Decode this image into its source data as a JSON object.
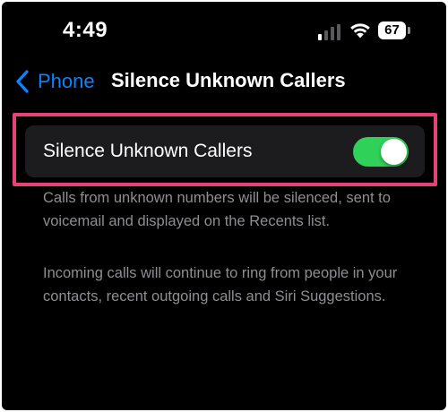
{
  "status_bar": {
    "time": "4:49",
    "battery_level": "67",
    "icons": [
      "cellular-signal-icon",
      "wifi-icon",
      "battery-icon"
    ]
  },
  "nav": {
    "back_label": "Phone",
    "back_icon": "chevron-left-icon",
    "title": "Silence Unknown Callers"
  },
  "setting": {
    "label": "Silence Unknown Callers",
    "toggle_on": true
  },
  "footer": {
    "paragraph_1": "Calls from unknown numbers will be silenced, sent to voicemail and displayed on the Recents list.",
    "paragraph_2": "Incoming calls will continue to ring from people in your contacts, recent outgoing calls and Siri Suggestions."
  },
  "colors": {
    "background": "#000000",
    "group_background": "#1c1c1e",
    "accent_blue": "#0a84ff",
    "toggle_green": "#30d158",
    "highlight": "#e5417a",
    "secondary_text": "#8e8e93"
  }
}
